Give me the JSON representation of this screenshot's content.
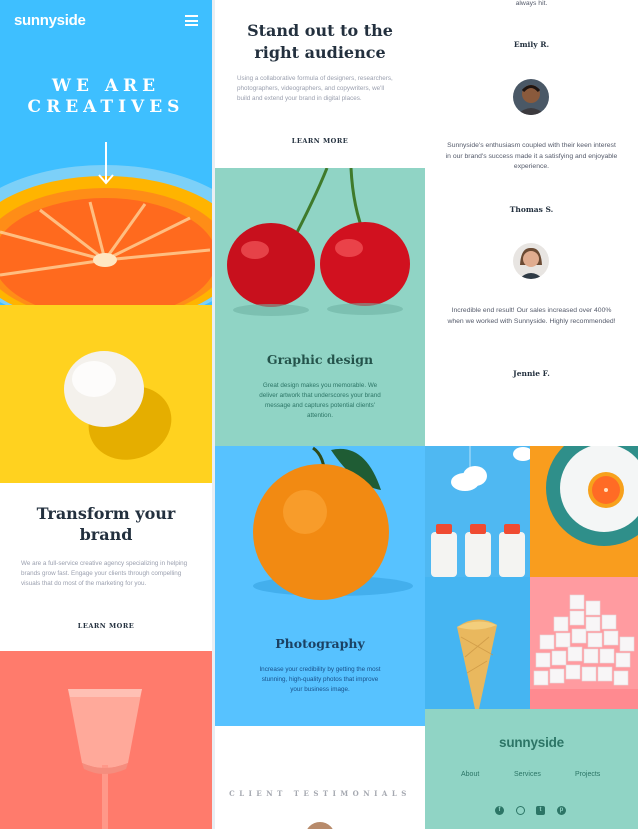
{
  "header": {
    "logo": "sunnyside",
    "menu_icon": "hamburger-menu-icon"
  },
  "hero": {
    "title_line1": "WE ARE",
    "title_line2": "CREATIVES",
    "arrow_icon": "arrow-down-icon"
  },
  "transform": {
    "title_line1": "Transform your",
    "title_line2": "brand",
    "body": "We are a full-service creative agency specializing in helping brands grow fast. Engage your clients through compelling visuals that do most of the marketing for you.",
    "learn_more": "LEARN MORE"
  },
  "standout": {
    "title_line1": "Stand out to the",
    "title_line2": "right audience",
    "body": "Using a collaborative formula of designers, researchers, photographers, videographers, and copywriters, we'll build and extend your brand in digital places.",
    "learn_more": "LEARN MORE"
  },
  "graphic_design": {
    "title": "Graphic design",
    "body": "Great design makes you memorable. We deliver artwork that underscores your brand message and captures potential clients' attention."
  },
  "photography": {
    "title": "Photography",
    "body": "Increase your credibility by getting the most stunning, high-quality photos that improve your business image."
  },
  "testimonials": {
    "heading": "CLIENT TESTIMONIALS",
    "items": [
      {
        "quote_tail": "always hit.",
        "name": "Emily R."
      },
      {
        "quote": "Sunnyside's enthusiasm coupled with their keen interest in our brand's success made it a satisfying and enjoyable experience.",
        "name": "Thomas S."
      },
      {
        "quote": "Incredible end result! Our sales increased over 400% when we worked with Sunnyside. Highly recommended!",
        "name": "Jennie F."
      }
    ]
  },
  "footer": {
    "logo": "sunnyside",
    "links": [
      "About",
      "Services",
      "Projects"
    ],
    "social_icons": [
      "facebook-icon",
      "instagram-icon",
      "twitter-icon",
      "pinterest-icon"
    ],
    "social_glyphs": [
      "f",
      "◎",
      "t",
      "p"
    ]
  },
  "colors": {
    "hero_blue": "#3ebfff",
    "egg_yellow": "#ffd21f",
    "coral": "#ff7b6c",
    "mint": "#90d4c5",
    "sky": "#57c2ff",
    "dark_text": "#23303e"
  }
}
